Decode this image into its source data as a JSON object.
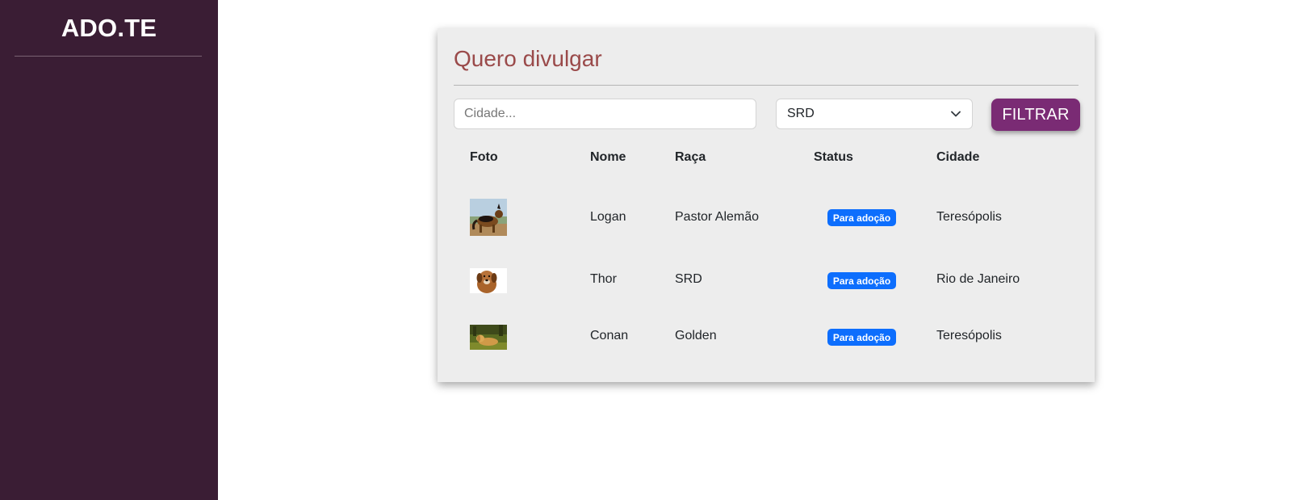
{
  "sidebar": {
    "brand": "ADO.TE"
  },
  "main": {
    "title": "Quero divulgar",
    "filters": {
      "city_placeholder": "Cidade...",
      "city_value": "",
      "breed_selected": "SRD",
      "filter_label": "FILTRAR"
    },
    "table": {
      "columns": [
        "Foto",
        "Nome",
        "Raça",
        "Status",
        "Cidade"
      ],
      "rows": [
        {
          "photo": "german-shepherd-photo",
          "name": "Logan",
          "breed": "Pastor Alemão",
          "status": "Para adoção",
          "city": "Teresópolis"
        },
        {
          "photo": "brown-dog-photo",
          "name": "Thor",
          "breed": "SRD",
          "status": "Para adoção",
          "city": "Rio de Janeiro"
        },
        {
          "photo": "golden-retriever-photo",
          "name": "Conan",
          "breed": "Golden",
          "status": "Para adoção",
          "city": "Teresópolis"
        }
      ]
    }
  },
  "colors": {
    "sidebar_bg": "#3a1d34",
    "title": "#9a4a4a",
    "button": "#7a2b74",
    "badge": "#0d6efd",
    "card_bg": "#ededed"
  }
}
